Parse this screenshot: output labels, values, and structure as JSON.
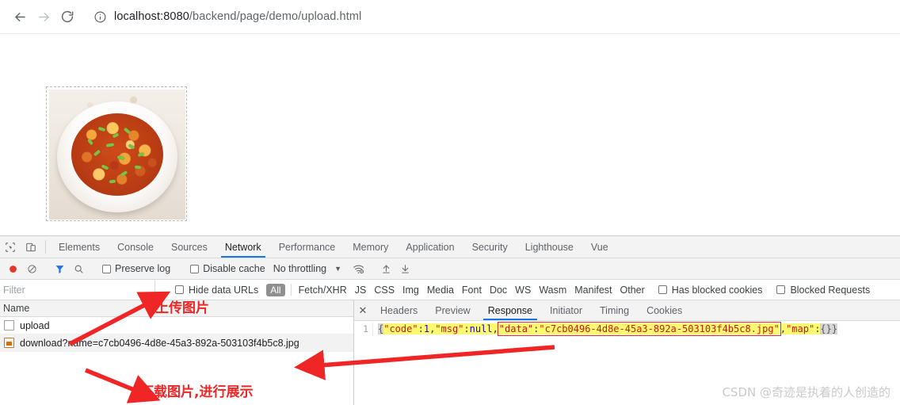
{
  "browser": {
    "back_icon": "arrow-left-icon",
    "forward_icon": "arrow-right-icon",
    "reload_icon": "reload-icon",
    "site_info_icon": "info-circle-icon",
    "url_host": "localhost:8080",
    "url_path": "/backend/page/demo/upload.html",
    "url_full": "localhost:8080/backend/page/demo/upload.html"
  },
  "page": {
    "image_alt": "mapo-tofu-photo",
    "image_border": "dashed"
  },
  "devtools": {
    "inspect_icon": "cursor-inspect-icon",
    "device_icon": "device-toolbar-icon",
    "tabs": [
      {
        "label": "Elements",
        "active": false
      },
      {
        "label": "Console",
        "active": false
      },
      {
        "label": "Sources",
        "active": false
      },
      {
        "label": "Network",
        "active": true
      },
      {
        "label": "Performance",
        "active": false
      },
      {
        "label": "Memory",
        "active": false
      },
      {
        "label": "Application",
        "active": false
      },
      {
        "label": "Security",
        "active": false
      },
      {
        "label": "Lighthouse",
        "active": false
      },
      {
        "label": "Vue",
        "active": false
      }
    ],
    "toolbar": {
      "record_icon": "record-circle-icon",
      "record_color": "#e8332a",
      "clear_icon": "clear-no-entry-icon",
      "filter_icon": "funnel-filter-icon",
      "filter_color": "#1a73e8",
      "search_icon": "search-magnifier-icon",
      "preserve_log_label": "Preserve log",
      "preserve_log_checked": false,
      "disable_cache_label": "Disable cache",
      "disable_cache_checked": false,
      "throttling_label": "No throttling",
      "throttling_caret": "chevron-down-icon",
      "wifi_icon": "wifi-settings-icon",
      "import_icon": "upload-arrow-icon",
      "export_icon": "download-arrow-icon"
    },
    "filterbar": {
      "filter_placeholder": "Filter",
      "filter_value": "",
      "hide_data_urls_label": "Hide data URLs",
      "hide_data_urls_checked": false,
      "type_all": "All",
      "types": [
        "Fetch/XHR",
        "JS",
        "CSS",
        "Img",
        "Media",
        "Font",
        "Doc",
        "WS",
        "Wasm",
        "Manifest",
        "Other"
      ],
      "has_blocked_cookies_label": "Has blocked cookies",
      "has_blocked_cookies_checked": false,
      "blocked_requests_label": "Blocked Requests",
      "blocked_requests_checked": false
    },
    "requests": {
      "column_name": "Name",
      "rows": [
        {
          "name": "upload",
          "icon": "document-icon",
          "selected": false
        },
        {
          "name": "download?name=c7cb0496-4d8e-45a3-892a-503103f4b5c8.jpg",
          "icon": "image-file-icon",
          "selected": true
        }
      ]
    },
    "detail": {
      "close_icon": "close-x-icon",
      "tabs": [
        {
          "label": "Headers",
          "active": false
        },
        {
          "label": "Preview",
          "active": false
        },
        {
          "label": "Response",
          "active": true
        },
        {
          "label": "Initiator",
          "active": false
        },
        {
          "label": "Timing",
          "active": false
        },
        {
          "label": "Cookies",
          "active": false
        }
      ],
      "response": {
        "line_number": "1",
        "raw": "{\"code\":1,\"msg\":null,\"data\":\"c7cb0496-4d8e-45a3-892a-503103f4b5c8.jpg\",\"map\":{}}",
        "open_brace": "{",
        "key_code": "\"code\"",
        "colon": ":",
        "val_code": "1",
        "comma1": ",",
        "key_msg": "\"msg\"",
        "val_msg": "null",
        "comma2": ",",
        "key_data": "\"data\"",
        "val_data": "\"c7cb0496-4d8e-45a3-892a-503103f4b5c8.jpg\"",
        "comma3": ",",
        "key_map": "\"map\"",
        "val_map": "{}",
        "close_brace": "}",
        "highlight_color": "#fdfa72",
        "box_color": "#f02626"
      }
    }
  },
  "annotations": {
    "color": "#f02626",
    "upload_note": "上传图片",
    "download_note": "下载图片,进行展示"
  },
  "watermark": {
    "text": "CSDN @奇迹是执着的人创造的"
  }
}
